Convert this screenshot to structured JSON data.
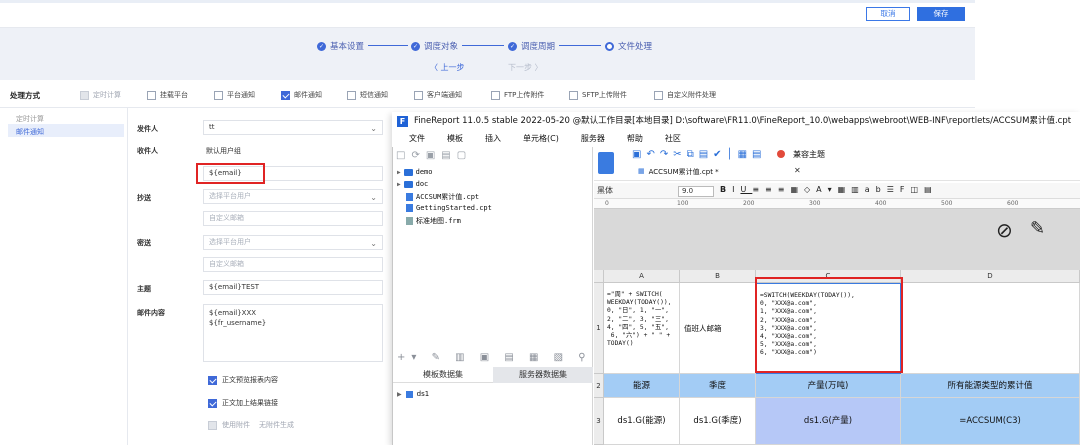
{
  "header": {
    "cancel_label": "取消",
    "save_label": "保存"
  },
  "steps": [
    {
      "label": "基本设置",
      "done": true
    },
    {
      "label": "调度对象",
      "done": true
    },
    {
      "label": "调度周期",
      "done": true
    },
    {
      "label": "文件处理",
      "done": false
    }
  ],
  "nav_buttons": {
    "prev": "〈 上一步",
    "next": "下一步 〉"
  },
  "method": {
    "label": "处理方式",
    "options": [
      {
        "label": "定时计算",
        "checked": false,
        "disabled": true
      },
      {
        "label": "挂载平台",
        "checked": false
      },
      {
        "label": "平台通知",
        "checked": false
      },
      {
        "label": "邮件通知",
        "checked": true
      },
      {
        "label": "短信通知",
        "checked": false
      },
      {
        "label": "客户端通知",
        "checked": false
      },
      {
        "label": "FTP上传附件",
        "checked": false
      },
      {
        "label": "SFTP上传附件",
        "checked": false
      },
      {
        "label": "自定义附件处理",
        "checked": false
      }
    ]
  },
  "sidebar": {
    "items": [
      {
        "label": "定时计算"
      },
      {
        "label": "邮件通知"
      }
    ]
  },
  "form": {
    "sender_label": "发件人",
    "sender_value": "tt",
    "recipient_label": "收件人",
    "recipient_group": "默认用户组",
    "recipient_value": "${email}",
    "cc_label": "抄送",
    "cc_select_ph": "选择平台用户",
    "cc_mail_ph": "自定义邮箱",
    "bcc_label": "密送",
    "bcc_select_ph": "选择平台用户",
    "bcc_mail_ph": "自定义邮箱",
    "subject_label": "主题",
    "subject_value": "${email}TEST",
    "body_label": "邮件内容",
    "body_line1": "${email}XXX",
    "body_line2": "${fr_username}",
    "opt1": "正文预览报表内容",
    "opt2": "正文加上结果链接",
    "opt3": "使用附件",
    "opt3_hint": "无附件生成"
  },
  "finereport": {
    "title": "FineReport 11.0.5 stable 2022-05-20 @默认工作目录[本地目录]   D:\\software\\FR11.0\\FineReport_10.0\\webapps\\webroot\\WEB-INF\\reportlets/ACCSUM累计值.cpt",
    "menus": [
      "文件",
      "模板",
      "插入",
      "单元格(C)",
      "服务器",
      "帮助",
      "社区"
    ],
    "tree": [
      {
        "label": "demo",
        "type": "folder"
      },
      {
        "label": "doc",
        "type": "folder"
      },
      {
        "label": "ACCSUM累计值.cpt",
        "type": "file"
      },
      {
        "label": "GettingStarted.cpt",
        "type": "file"
      },
      {
        "label": "标准地图.frm",
        "type": "file"
      }
    ],
    "tab_template_ds": "模板数据集",
    "tab_server_ds": "服务器数据集",
    "dataset": "ds1",
    "compat_label": "兼容主题",
    "doc_tab": "ACCSUM累计值.cpt *",
    "font_name": "黑体",
    "font_size": "9.0",
    "ruler": [
      "0",
      "100",
      "200",
      "300",
      "400",
      "500",
      "600",
      "700"
    ],
    "columns": [
      "A",
      "B",
      "C",
      "D"
    ],
    "rows": [
      "1",
      "2",
      "3"
    ],
    "a1": "=\"周\" + SWITCH(\nWEEKDAY(TODAY()),\n0, \"日\", 1, \"一\",\n2, \"二\", 3, \"三\",\n4, \"四\", 5, \"五\",\n 6, \"六\") + \" \" +\nTODAY()",
    "b1": "值班人邮箱",
    "c1": "=SWITCH(WEEKDAY(TODAY()),\n0, \"XXX@a.com\",\n1, \"XXX@a.com\",\n2, \"XXX@a.com\",\n3, \"XXX@a.com\",\n4, \"XXX@a.com\",\n5, \"XXX@a.com\",\n6, \"XXX@a.com\")",
    "row2": [
      "能源",
      "季度",
      "产量(万吨)",
      "所有能源类型的累计值"
    ],
    "row3": [
      "ds1.G(能源)",
      "ds1.G(季度)",
      "ds1.G(产量)",
      "=ACCSUM(C3)"
    ]
  }
}
